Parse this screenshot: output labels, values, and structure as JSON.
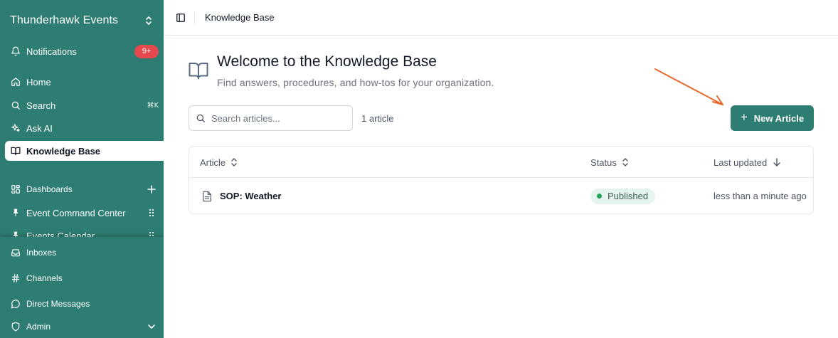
{
  "sidebar": {
    "workspace_name": "Thunderhawk Events",
    "notifications": {
      "label": "Notifications",
      "badge": "9+"
    },
    "nav": {
      "home": "Home",
      "search": "Search",
      "search_shortcut": "⌘K",
      "ask_ai": "Ask AI",
      "knowledge_base": "Knowledge Base"
    },
    "dashboards": {
      "label": "Dashboards",
      "items": [
        {
          "label": "Event Command Center"
        },
        {
          "label": "Events Calendar"
        }
      ]
    },
    "bottom": {
      "inboxes": "Inboxes",
      "channels": "Channels",
      "direct_messages": "Direct Messages",
      "admin": "Admin"
    }
  },
  "topbar": {
    "breadcrumb": "Knowledge Base"
  },
  "page": {
    "title": "Welcome to the Knowledge Base",
    "subtitle": "Find answers, procedures, and how-tos for your organization.",
    "search_placeholder": "Search articles...",
    "count": "1 article",
    "new_button": "New Article"
  },
  "table": {
    "columns": {
      "article": "Article",
      "status": "Status",
      "updated": "Last updated"
    },
    "rows": [
      {
        "title": "SOP: Weather",
        "status": "Published",
        "updated": "less than a minute ago"
      }
    ]
  },
  "colors": {
    "sidebar": "#2e7d72",
    "primary_button": "#2e7d72",
    "badge": "#e5484d",
    "published_dot": "#22a35a",
    "annotation_arrow": "#e8692c"
  },
  "icons": {
    "hero": "book-open-icon",
    "search": "search-icon",
    "document": "file-text-icon"
  }
}
